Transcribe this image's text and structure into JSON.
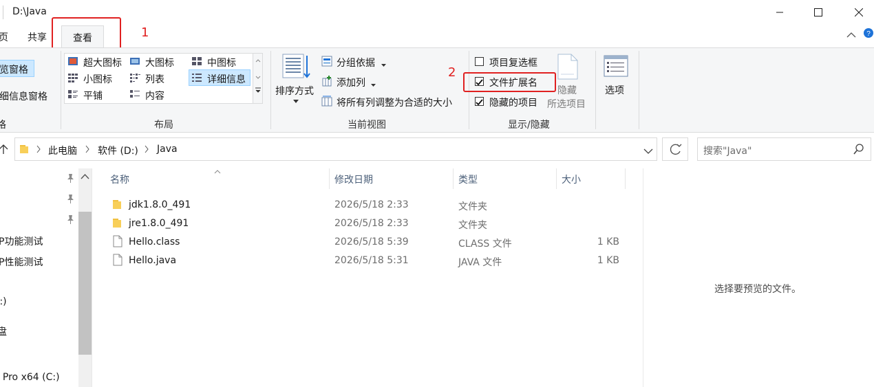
{
  "window": {
    "title": "D:\\Java"
  },
  "tabs": {
    "partial": "页",
    "share": "共享",
    "view": "查看"
  },
  "annotations": {
    "callout1": "1",
    "callout2": "2"
  },
  "ribbon": {
    "panes": {
      "preview_pane": "览窗格",
      "details_pane": "细信息窗格",
      "group_partial": "格"
    },
    "layout": {
      "extra_large_icons": "超大图标",
      "large_icons": "大图标",
      "medium_icons": "中图标",
      "small_icons": "小图标",
      "list": "列表",
      "details": "详细信息",
      "tiles": "平铺",
      "content": "内容",
      "group_label": "布局"
    },
    "current_view": {
      "sort_by": "排序方式",
      "group_by": "分组依据",
      "add_columns": "添加列",
      "size_all_columns": "将所有列调整为合适的大小",
      "group_label": "当前视图"
    },
    "show_hide": {
      "item_checkboxes": "项目复选框",
      "file_name_extensions": "文件扩展名",
      "hidden_items": "隐藏的项目",
      "hide_selected_line1": "隐藏",
      "hide_selected_line2": "所选项目",
      "group_label": "显示/隐藏"
    },
    "options": "选项"
  },
  "address": {
    "crumbs": [
      "此电脑",
      "软件 (D:)",
      "Java"
    ],
    "search_placeholder": "搜索\"Java\""
  },
  "nav": {
    "items": [
      "P功能测试",
      "P性能测试",
      "):)",
      "盘",
      ") Pro x64 (C:)"
    ]
  },
  "files": {
    "columns": {
      "name": "名称",
      "modified": "修改日期",
      "type": "类型",
      "size": "大小"
    },
    "rows": [
      {
        "name": "jdk1.8.0_491",
        "modified": "2026/5/18 2:33",
        "type": "文件夹",
        "size": "",
        "icon": "folder-icon"
      },
      {
        "name": "jre1.8.0_491",
        "modified": "2026/5/18 2:33",
        "type": "文件夹",
        "size": "",
        "icon": "folder-icon"
      },
      {
        "name": "Hello.class",
        "modified": "2026/5/18 5:39",
        "type": "CLASS 文件",
        "size": "1 KB",
        "icon": "file-icon"
      },
      {
        "name": "Hello.java",
        "modified": "2026/5/18 5:31",
        "type": "JAVA 文件",
        "size": "1 KB",
        "icon": "file-icon"
      }
    ]
  },
  "preview": {
    "message": "选择要预览的文件。"
  },
  "colors": {
    "highlight": "#cce8ff",
    "callout": "#e02020",
    "folder": "#f8cf59"
  }
}
